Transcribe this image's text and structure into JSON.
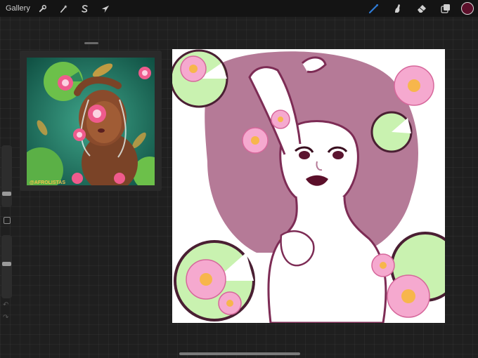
{
  "topbar": {
    "gallery_label": "Gallery",
    "left_tools": [
      {
        "name": "actions",
        "icon": "wrench-icon"
      },
      {
        "name": "adjustments",
        "icon": "magic-wand-icon"
      },
      {
        "name": "selection",
        "icon": "selection-s-icon"
      },
      {
        "name": "transform",
        "icon": "arrow-cursor-icon"
      }
    ],
    "right_tools": [
      {
        "name": "brush",
        "icon": "brush-icon",
        "active": true
      },
      {
        "name": "smudge",
        "icon": "smudge-icon"
      },
      {
        "name": "eraser",
        "icon": "eraser-icon"
      },
      {
        "name": "layers",
        "icon": "layers-icon"
      }
    ],
    "current_color": "#5b0f2a",
    "active_tool_color": "#2f7bd6"
  },
  "sidebar": {
    "brush_size_level": 0.2,
    "opacity_level": 0.55,
    "modify_icon": "square-modify-icon",
    "undo_icon": "undo-icon",
    "redo_icon": "redo-icon"
  },
  "reference": {
    "watermark": "@AFROLISTAS"
  },
  "canvas": {
    "palette": {
      "hair": "#b57a97",
      "line": "#7d2c55",
      "lily_pad": "#c9f2b0",
      "pad_outline": "#4a1f33",
      "lotus_pink": "#f5a9cf",
      "lotus_center": "#f7b64c",
      "lips": "#5b0f2a"
    }
  }
}
